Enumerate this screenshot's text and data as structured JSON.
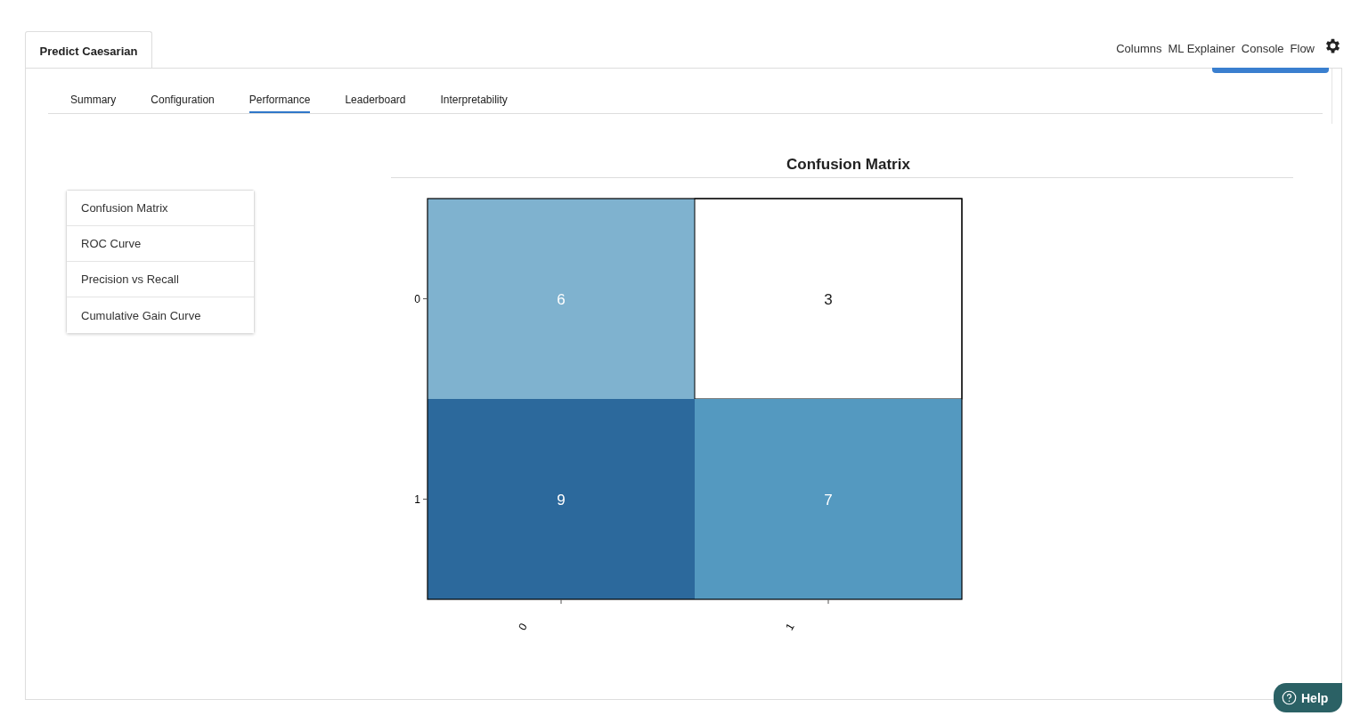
{
  "header": {
    "title_tab": "Predict Caesarian",
    "nav_links": [
      "Columns",
      "ML Explainer",
      "Console",
      "Flow"
    ]
  },
  "tabs": [
    {
      "label": "Summary",
      "selected": false
    },
    {
      "label": "Configuration",
      "selected": false
    },
    {
      "label": "Performance",
      "selected": true
    },
    {
      "label": "Leaderboard",
      "selected": false
    },
    {
      "label": "Interpretability",
      "selected": false
    }
  ],
  "sidebar": {
    "items": [
      "Confusion Matrix",
      "ROC Curve",
      "Precision vs Recall",
      "Cumulative Gain Curve"
    ]
  },
  "confusion_matrix": {
    "title": "Confusion Matrix",
    "row_labels": [
      "0",
      "1"
    ],
    "column_labels": [
      "0",
      "1"
    ],
    "cells": [
      [
        {
          "value": "6",
          "color": "#7fb2cf"
        },
        {
          "value": "3",
          "color": "#ffffff"
        }
      ],
      [
        {
          "value": "9",
          "color": "#2c699c"
        },
        {
          "value": "7",
          "color": "#5499c0"
        }
      ]
    ]
  },
  "help_button": "Help"
}
